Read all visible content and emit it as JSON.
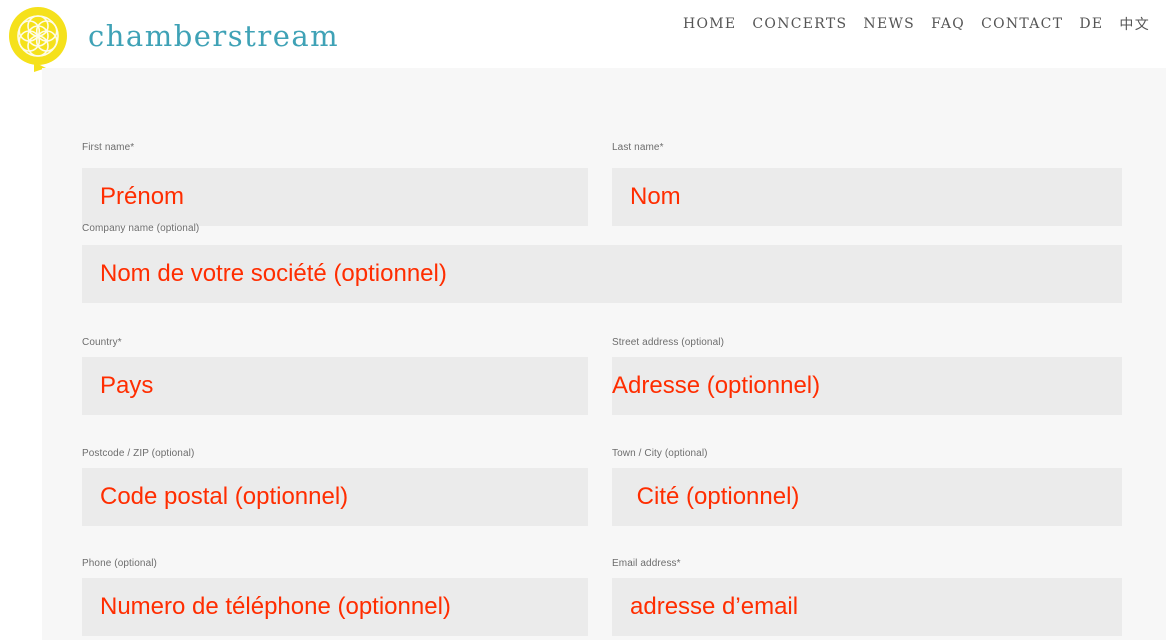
{
  "header": {
    "logo_text": "chamberstream",
    "logo_icon": "flower-of-life-icon",
    "nav": [
      "HOME",
      "CONCERTS",
      "NEWS",
      "FAQ",
      "CONTACT",
      "DE",
      "中文"
    ]
  },
  "colors": {
    "logo_text": "#3fa2b6",
    "logo_mark": "#f5e11b",
    "placeholder": "#ff2d00",
    "field_bg": "#ebebeb",
    "panel_bg": "#f7f7f7"
  },
  "form": {
    "first_name": {
      "label": "First name*",
      "placeholder": "Prénom"
    },
    "last_name": {
      "label": "Last name*",
      "placeholder": "Nom"
    },
    "company": {
      "label": "Company name (optional)",
      "placeholder": "Nom de votre société (optionnel)"
    },
    "country": {
      "label": "Country*",
      "placeholder": "Pays"
    },
    "street": {
      "label": "Street address (optional)",
      "placeholder": "Adresse (optionnel)"
    },
    "postcode": {
      "label": "Postcode / ZIP (optional)",
      "placeholder": "Code postal (optionnel)"
    },
    "town": {
      "label": "Town / City (optional)",
      "placeholder": " Cité (optionnel)"
    },
    "phone": {
      "label": "Phone (optional)",
      "placeholder": "Numero de téléphone (optionnel)"
    },
    "email": {
      "label": "Email address*",
      "placeholder": "adresse d’email"
    }
  }
}
